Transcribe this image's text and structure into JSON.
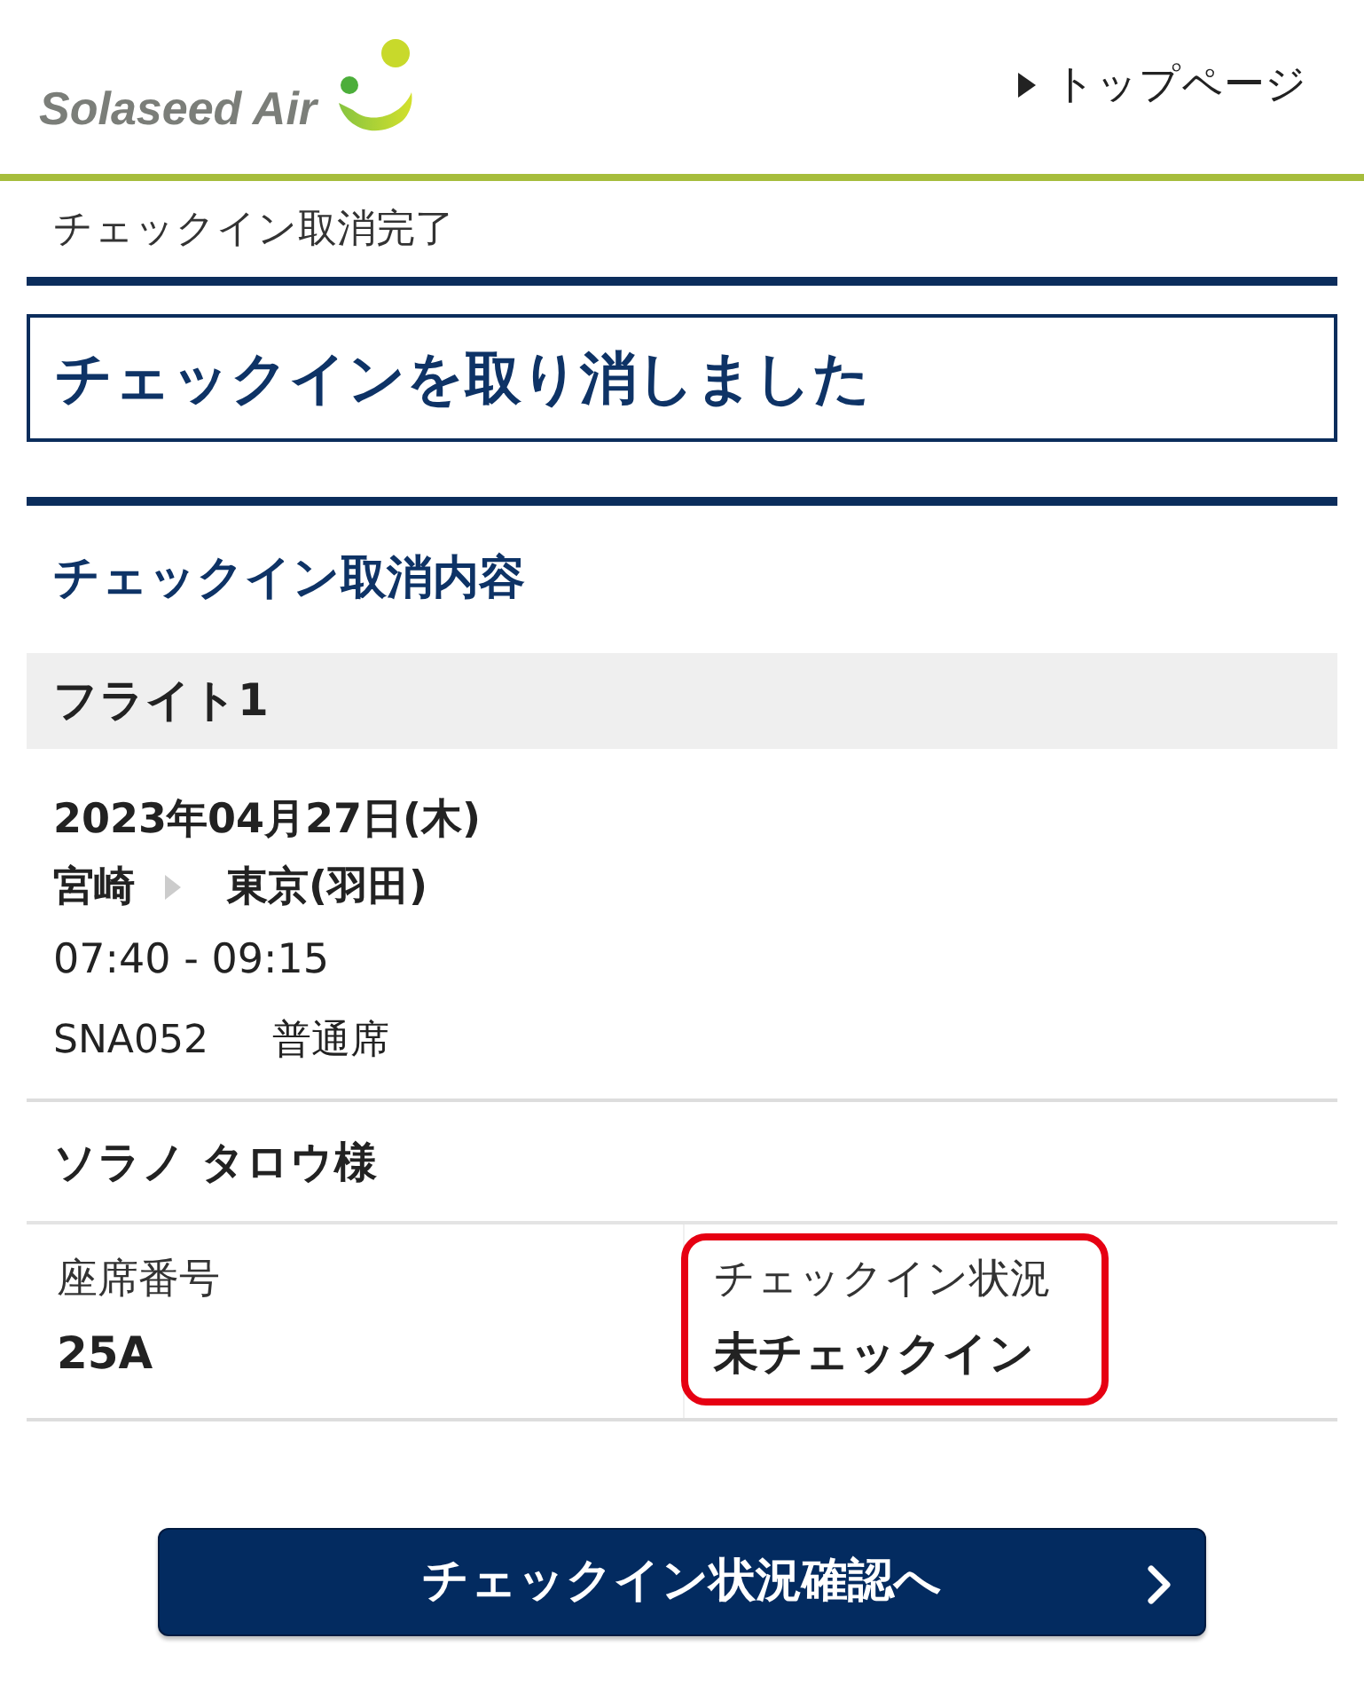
{
  "header": {
    "logo_text": "Solaseed Air",
    "top_link": "トップページ"
  },
  "breadcrumb": "チェックイン取消完了",
  "page_title": "チェックインを取り消しました",
  "section_heading": "チェックイン取消内容",
  "flights": [
    {
      "label": "フライト1",
      "date": "2023年04月27日(木)",
      "origin": "宮崎",
      "destination": "東京(羽田)",
      "time": "07:40 - 09:15",
      "flight_number": "SNA052",
      "seat_class": "普通席",
      "passengers": [
        {
          "name": "ソラノ タロウ様",
          "fields": [
            {
              "label": "座席番号",
              "value": "25A",
              "highlighted": false
            },
            {
              "label": "チェックイン状況",
              "value": "未チェックイン",
              "highlighted": true
            }
          ]
        }
      ]
    }
  ],
  "button": {
    "label": "チェックイン状況確認へ"
  }
}
